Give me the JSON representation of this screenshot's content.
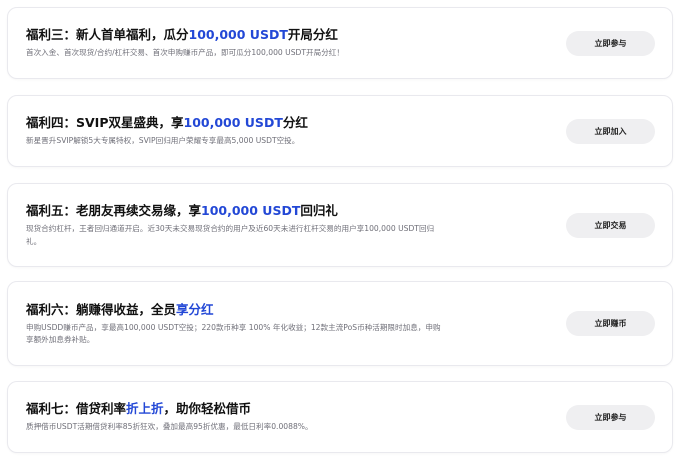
{
  "cards": [
    {
      "title_prefix": "福利三：新人首单福利，瓜分",
      "title_highlight": "100,000 USDT",
      "title_suffix": "开局分红",
      "description": "首次入金、首次现货/合约/杠杆交易、首次申购赚币产品，即可瓜分100,000 USDT开局分红！",
      "button_label": "立即参与"
    },
    {
      "title_prefix": "福利四：SVIP双星盛典，享",
      "title_highlight": "100,000 USDT",
      "title_suffix": "分红",
      "description": "新星晋升SVIP解锁5大专属特权，SVIP回归用户荣耀专享最高5,000 USDT空投。",
      "button_label": "立即加入"
    },
    {
      "title_prefix": "福利五：老朋友再续交易缘，享",
      "title_highlight": "100,000 USDT",
      "title_suffix": "回归礼",
      "description": "现货合约杠杆，王者回归通道开启。近30天未交易现货合约的用户及近60天未进行杠杆交易的用户享100,000 USDT回归礼。",
      "button_label": "立即交易"
    },
    {
      "title_prefix": "福利六：躺赚得收益，全员",
      "title_highlight": "享分红",
      "title_suffix": "",
      "description": "申购USDD赚币产品，享最高100,000 USDT空投；220款币种享 100% 年化收益；12款主流PoS币种活期限时加息，申购享额外加息券补贴。",
      "button_label": "立即赚币"
    },
    {
      "title_prefix": "福利七：借贷利率",
      "title_highlight": "折上折",
      "title_suffix": "，助你轻松借币",
      "description": "质押借币USDT活期借贷利率85折狂欢，叠加最高95折优惠，最低日利率0.0088%。",
      "button_label": "立即参与"
    }
  ],
  "colors": {
    "highlight": "#2348d6",
    "button_bg": "#efeff1",
    "card_border": "#e9e9ee"
  }
}
